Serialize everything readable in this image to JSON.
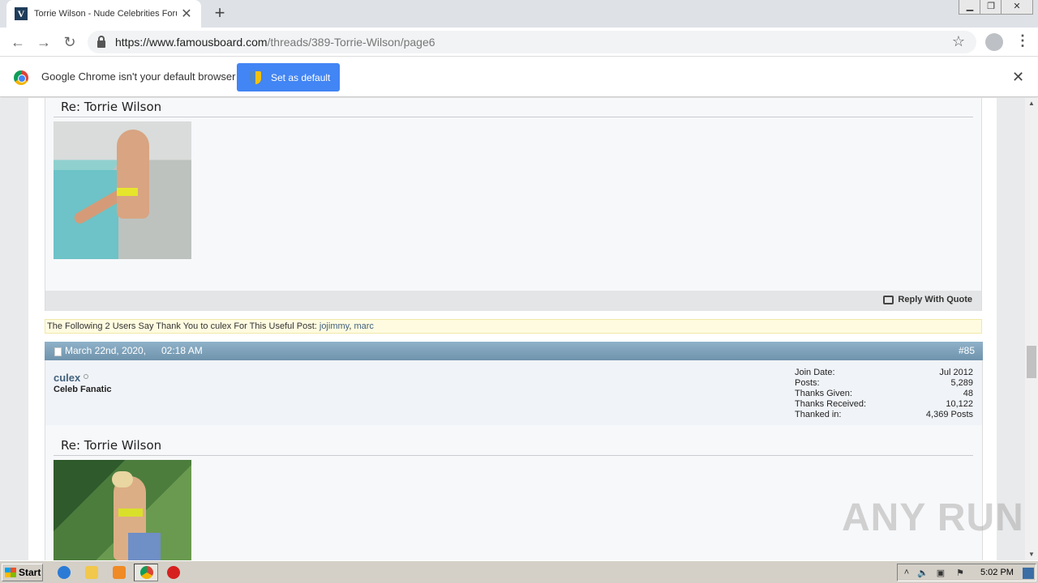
{
  "browser": {
    "tab_title": "Torrie Wilson - Nude Celebrities Forum",
    "favicon_letter": "V",
    "url_domain": "https://www.famousboard.com",
    "url_path": "/threads/389-Torrie-Wilson/page6",
    "infobar_text": "Google Chrome isn't your default browser",
    "set_default_label": "Set as default"
  },
  "post1": {
    "title": "Re: Torrie Wilson",
    "reply_with_quote": "Reply With Quote",
    "thanks_prefix": "The Following 2 Users Say Thank You to culex For This Useful Post:",
    "thanks_users": [
      "jojimmy",
      "marc"
    ],
    "thanks_separator": ", "
  },
  "post2": {
    "date": "March 22nd, 2020,",
    "time": "02:18 AM",
    "number": "#85",
    "username": "culex",
    "usertitle": "Celeb Fanatic",
    "stats": [
      {
        "label": "Join Date:",
        "value": "Jul 2012"
      },
      {
        "label": "Posts:",
        "value": "5,289"
      },
      {
        "label": "Thanks Given:",
        "value": "48"
      },
      {
        "label": "Thanks Received:",
        "value": "10,122"
      },
      {
        "label": "Thanked in:",
        "value": "4,369 Posts"
      }
    ],
    "title": "Re: Torrie Wilson"
  },
  "watermark": "ANY RUN",
  "taskbar": {
    "start_label": "Start",
    "clock": "5:02 PM"
  },
  "colors": {
    "post_header": "#7a9db5",
    "link": "#41617d",
    "thanks_bg": "#fffbe0",
    "chrome_button": "#4285f4"
  }
}
